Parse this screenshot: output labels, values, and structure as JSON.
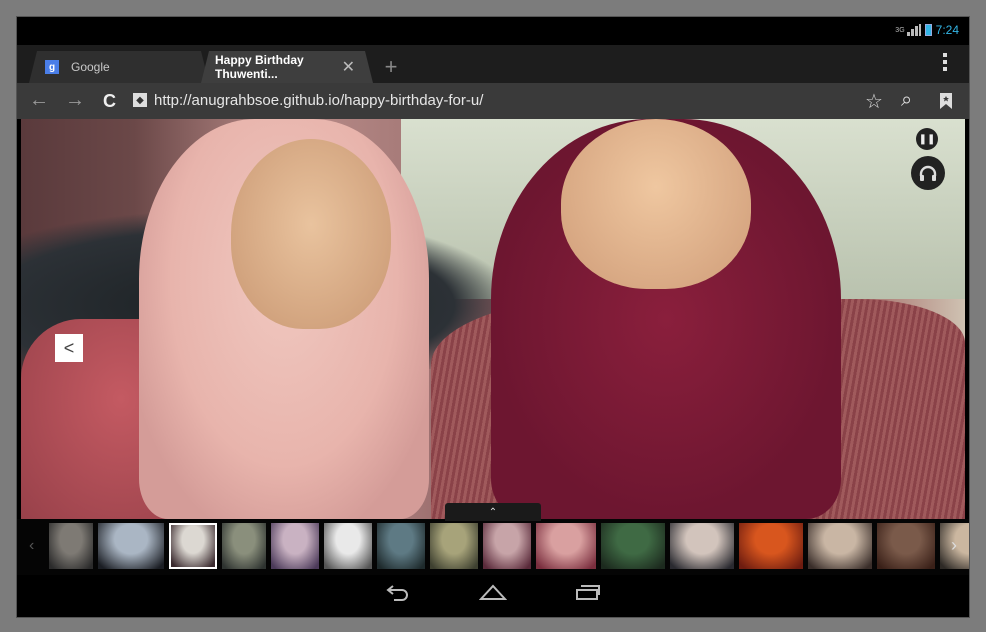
{
  "status": {
    "signal_label": "3G",
    "time": "7:24"
  },
  "tabs": [
    {
      "icon": "google-favicon-icon",
      "icon_letter": "g",
      "label": "Google"
    },
    {
      "label": "Happy Birthday Thuwenti...",
      "close": "✕"
    }
  ],
  "new_tab": "+",
  "address": {
    "back": "←",
    "forward": "→",
    "reload": "C",
    "url": "http://anugrahbsoe.github.io/happy-birthday-for-u/",
    "star": "☆",
    "search": "⌕",
    "bookmark": "bookmark-icon"
  },
  "gallery": {
    "prev": "<",
    "next": ">",
    "pause": "❚❚",
    "handle": "⌃",
    "thumbnail_count": 17,
    "selected_thumbnail": 3
  },
  "colors": {
    "accent": "#33b5e5",
    "frame": "#7c7c7c"
  }
}
